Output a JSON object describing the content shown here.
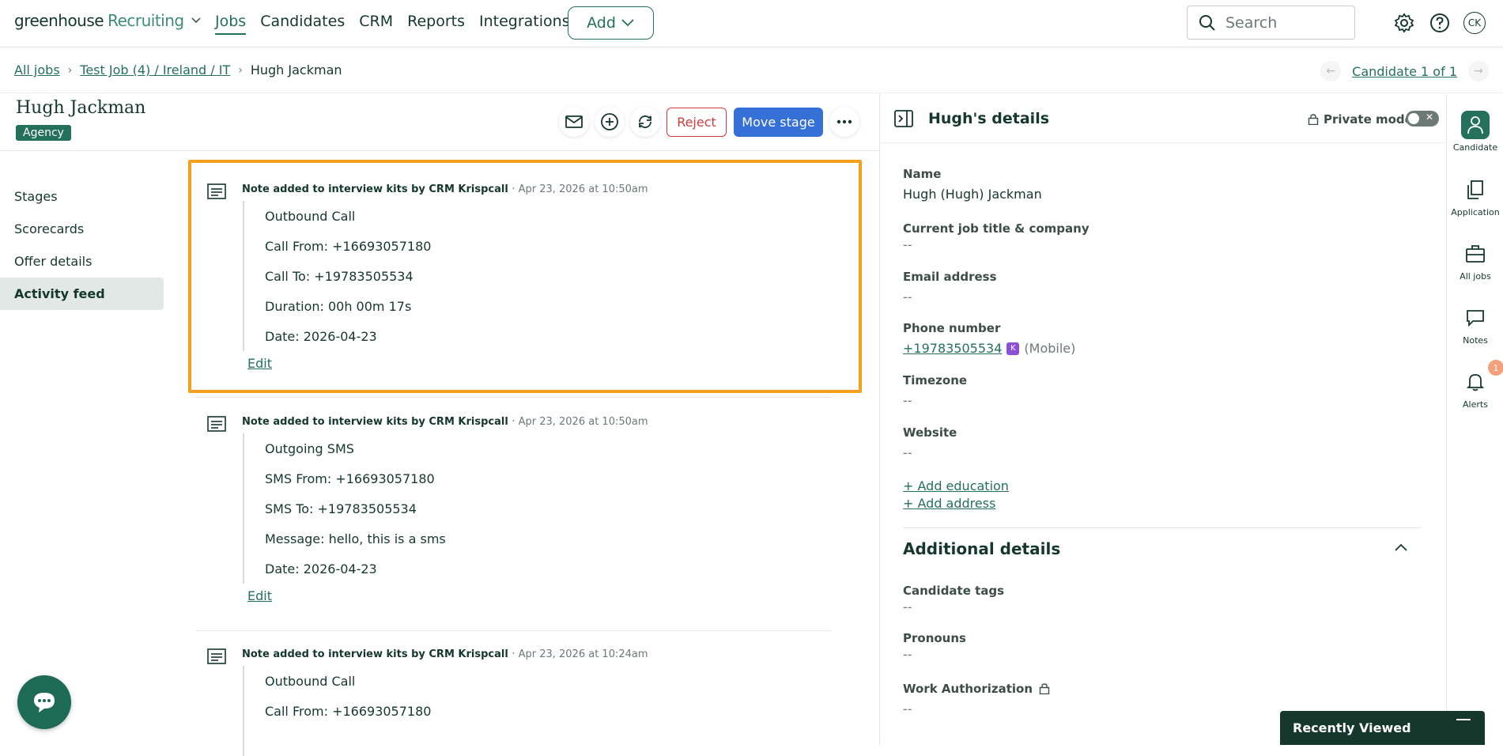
{
  "nav": {
    "logo_main": "greenhouse",
    "logo_sub": "Recruiting",
    "links": [
      "Jobs",
      "Candidates",
      "CRM",
      "Reports",
      "Integrations"
    ],
    "add_label": "Add",
    "search_placeholder": "Search",
    "user_initials": "CK"
  },
  "breadcrumb": {
    "all_jobs": "All jobs",
    "job": "Test Job (4) / Ireland / IT",
    "current": "Hugh Jackman",
    "candidate_pager": "Candidate 1 of 1"
  },
  "candidate": {
    "name": "Hugh Jackman",
    "source_badge": "Agency"
  },
  "actions": {
    "reject": "Reject",
    "move_stage": "Move stage"
  },
  "left_nav": {
    "items": [
      "Stages",
      "Scorecards",
      "Offer details",
      "Activity feed"
    ],
    "active": "Activity feed"
  },
  "feed": [
    {
      "title": "Note added to interview kits by CRM Krispcall",
      "date": "Apr 23, 2026 at 10:50am",
      "lines": [
        "Outbound Call",
        "Call From: +16693057180",
        "Call To: +19783505534",
        "Duration: 00h 00m 17s",
        "Date: 2026-04-23"
      ],
      "edit": "Edit"
    },
    {
      "title": "Note added to interview kits by CRM Krispcall",
      "date": "Apr 23, 2026 at 10:50am",
      "lines": [
        "Outgoing SMS",
        "SMS From: +16693057180",
        "SMS To: +19783505534",
        "Message: hello, this is a sms",
        "Date: 2026-04-23"
      ],
      "edit": "Edit"
    },
    {
      "title": "Note added to interview kits by CRM Krispcall",
      "date": "Apr 23, 2026 at 10:24am",
      "lines": [
        "Outbound Call",
        "Call From: +16693057180"
      ],
      "edit": ""
    }
  ],
  "details": {
    "title": "Hugh's details",
    "private_mode": "Private mode",
    "fields": {
      "name_label": "Name",
      "name_value": "Hugh (Hugh) Jackman",
      "job_label": "Current job title & company",
      "job_value": "--",
      "email_label": "Email address",
      "email_value": "--",
      "phone_label": "Phone number",
      "phone_value": "+19783505534",
      "phone_type": "(Mobile)",
      "timezone_label": "Timezone",
      "timezone_value": "--",
      "website_label": "Website",
      "website_value": "--"
    },
    "add_education": "+ Add education",
    "add_address": "+ Add address",
    "additional_title": "Additional details",
    "additional": {
      "tags_label": "Candidate tags",
      "tags_value": "--",
      "pronouns_label": "Pronouns",
      "pronouns_value": "--",
      "work_label": "Work Authorization",
      "work_value": "--"
    }
  },
  "rail": {
    "candidate": "Candidate",
    "application": "Application",
    "all_jobs": "All jobs",
    "notes": "Notes",
    "alerts": "Alerts",
    "alerts_count": "1"
  },
  "recently_viewed": "Recently Viewed"
}
